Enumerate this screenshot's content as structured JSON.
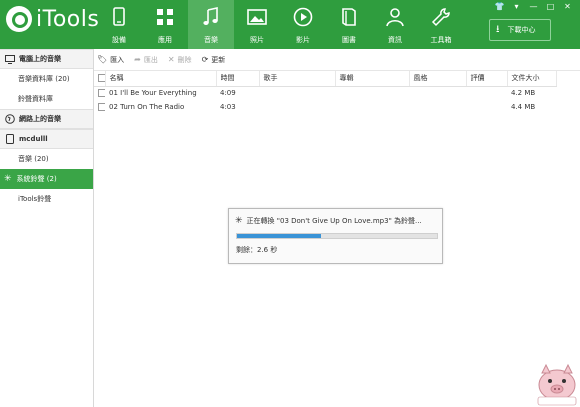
{
  "app": {
    "logo_text": "iTools"
  },
  "nav": [
    {
      "label": "設備",
      "icon": "device-icon",
      "active": false
    },
    {
      "label": "應用",
      "icon": "apps-icon",
      "active": false
    },
    {
      "label": "音樂",
      "icon": "music-icon",
      "active": true
    },
    {
      "label": "照片",
      "icon": "photo-icon",
      "active": false
    },
    {
      "label": "影片",
      "icon": "video-icon",
      "active": false
    },
    {
      "label": "圖書",
      "icon": "book-icon",
      "active": false
    },
    {
      "label": "資訊",
      "icon": "person-icon",
      "active": false
    },
    {
      "label": "工具箱",
      "icon": "wrench-icon",
      "active": false
    }
  ],
  "download_center": {
    "label": "下載中心"
  },
  "sidebar": {
    "section_pc": "電腦上的音樂",
    "pc_items": [
      "音樂資料庫 (20)",
      "鈴聲資料庫"
    ],
    "section_net": "網路上的音樂",
    "section_device": "mcdulll",
    "device_items": [
      {
        "label": "音樂 (20)",
        "active": false
      },
      {
        "label": "系統鈴聲 (2)",
        "active": true
      },
      {
        "label": "iTools鈴聲",
        "active": false
      }
    ]
  },
  "toolbar": {
    "import": "匯入",
    "export": "匯出",
    "delete": "刪除",
    "refresh": "更新"
  },
  "table": {
    "headers": [
      "名稱",
      "時間",
      "歌手",
      "專輯",
      "風格",
      "評價",
      "文件大小"
    ],
    "rows": [
      {
        "name": "01 I'll Be Your Everything",
        "time": "4:09",
        "artist": "",
        "album": "",
        "genre": "",
        "rating": "",
        "size": "4.2 MB"
      },
      {
        "name": "02 Turn On The Radio",
        "time": "4:03",
        "artist": "",
        "album": "",
        "genre": "",
        "rating": "",
        "size": "4.4 MB"
      }
    ]
  },
  "dialog": {
    "message": "正在轉換 \"03 Don't Give Up On Love.mp3\" 為鈴聲...",
    "progress": 0.42,
    "remaining": "剩餘：2.6 秒"
  },
  "colors": {
    "brand": "#2f9d3e",
    "active_nav": "#53b05f",
    "progress": "#3a93d6"
  }
}
